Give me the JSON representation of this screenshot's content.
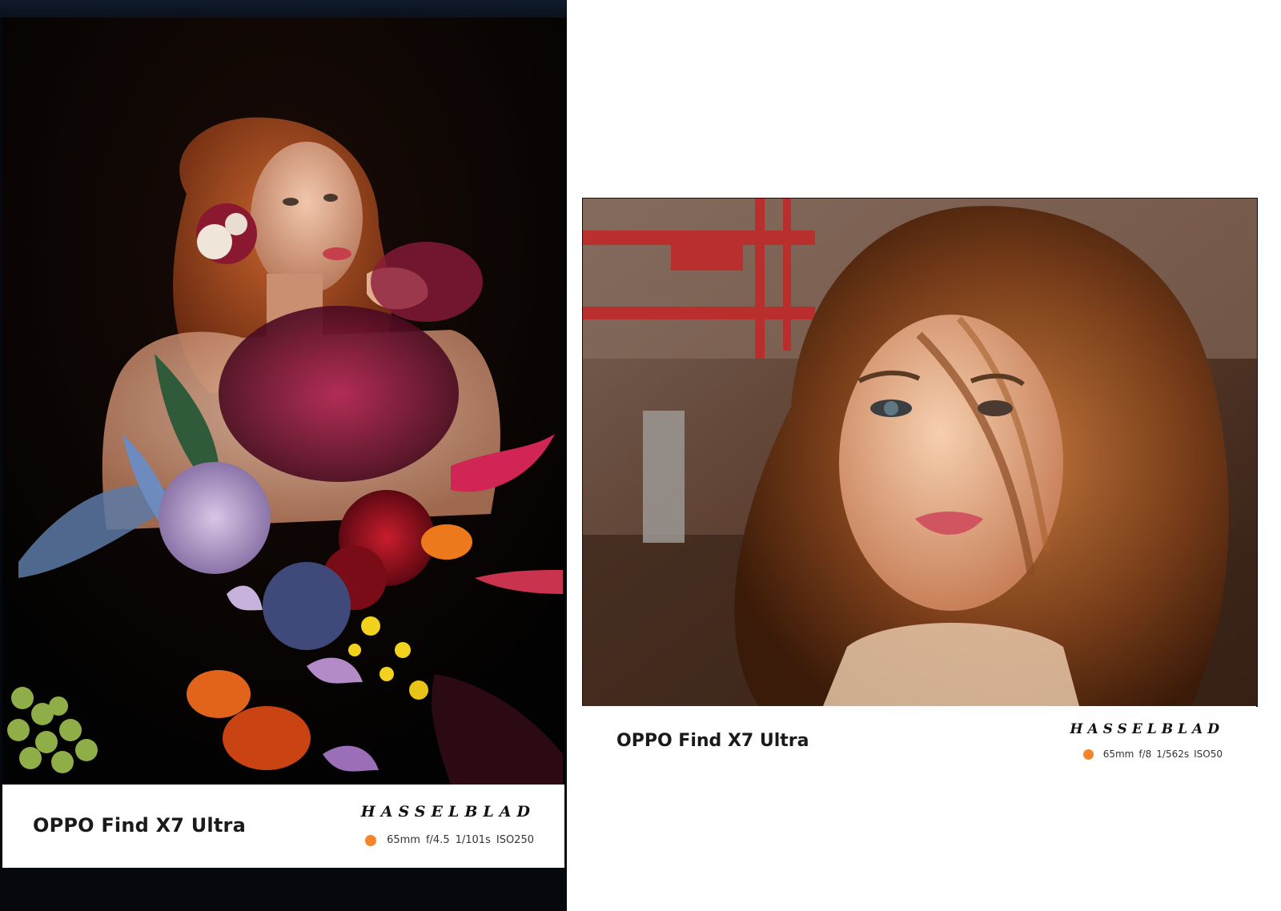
{
  "left_card": {
    "model": "OPPO Find X7 Ultra",
    "brand": "HASSELBLAD",
    "exif": {
      "focal_length": "65mm",
      "aperture": "f/4.5",
      "shutter": "1/101s",
      "iso": "ISO250"
    },
    "dot_color": "#f5842a"
  },
  "right_card": {
    "model": "OPPO Find X7 Ultra",
    "brand": "HASSELBLAD",
    "exif": {
      "focal_length": "65mm",
      "aperture": "f/8",
      "shutter": "1/562s",
      "iso": "ISO50"
    },
    "dot_color": "#f5842a"
  }
}
